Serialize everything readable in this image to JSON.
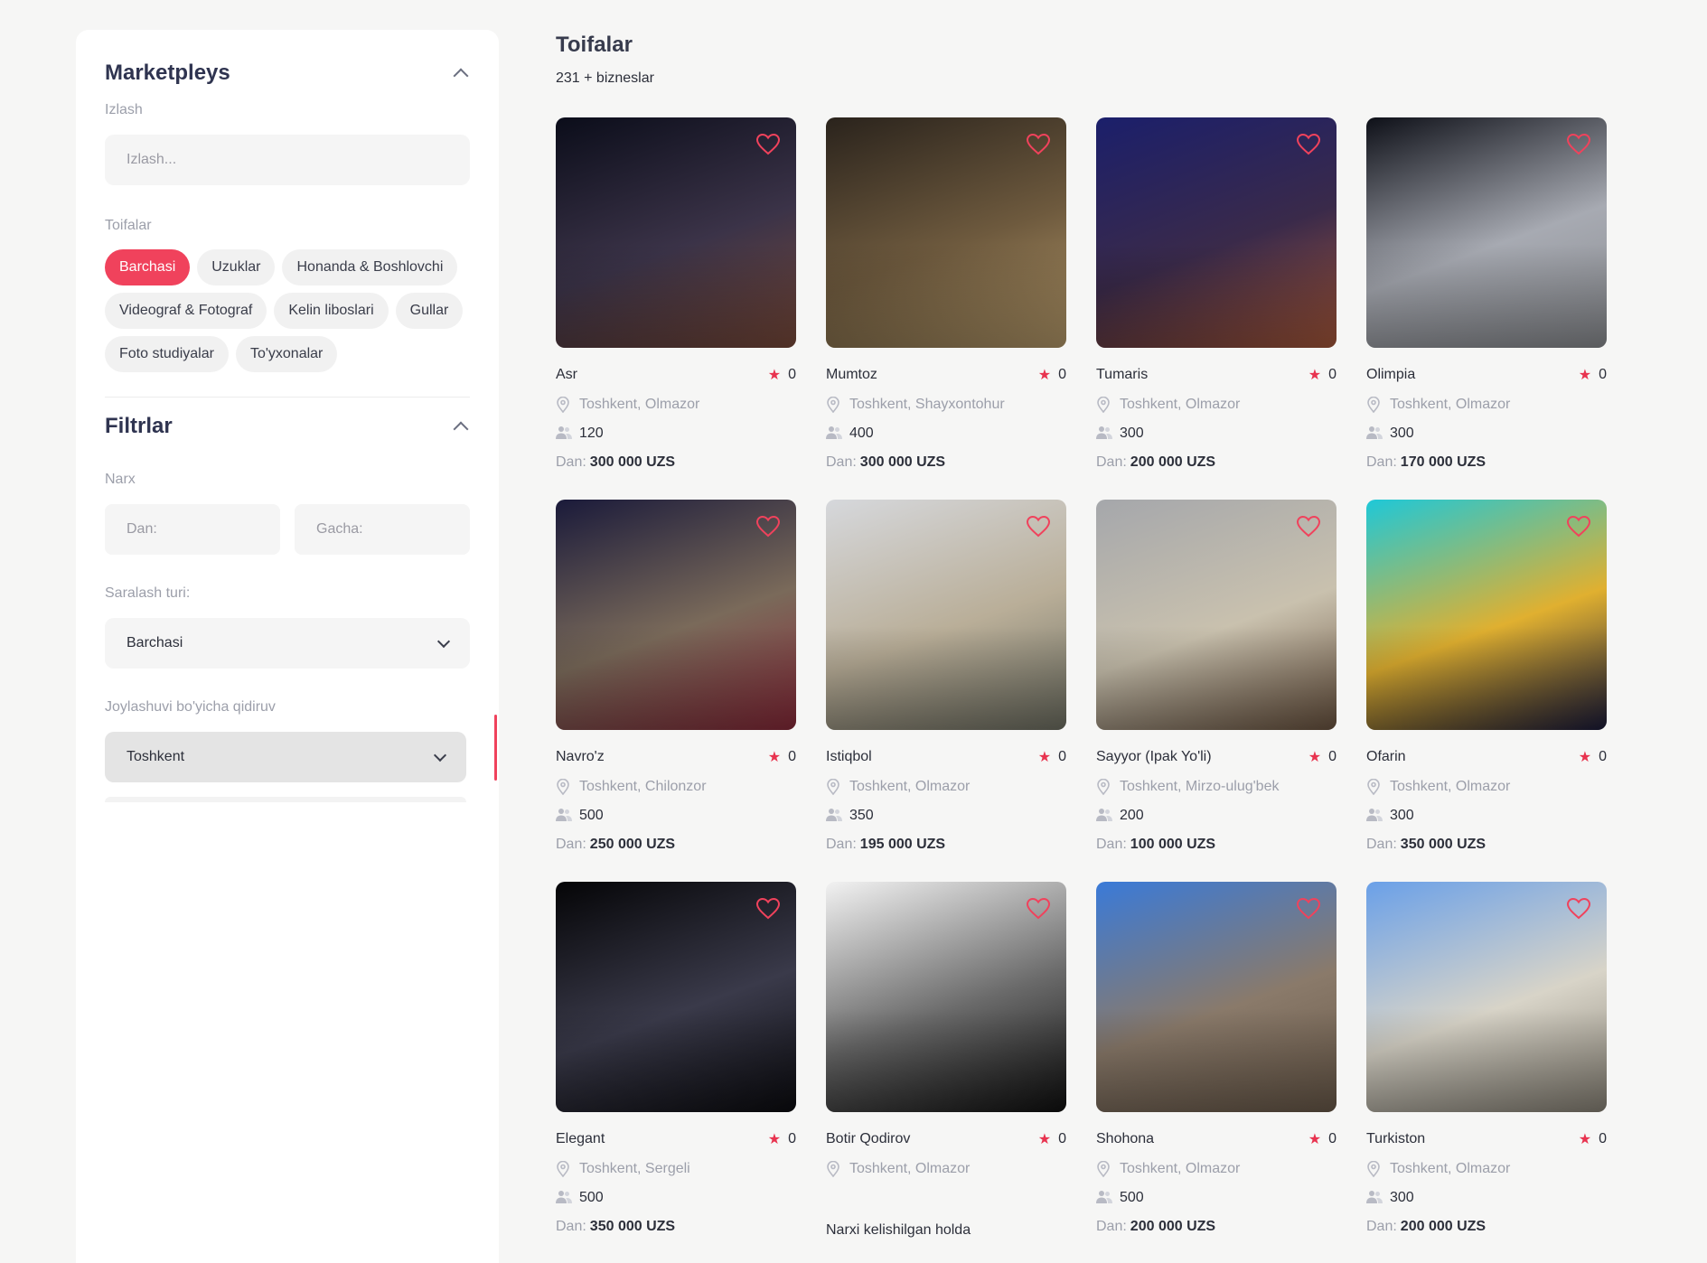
{
  "sidebar": {
    "marketplace_title": "Marketpleys",
    "search_label": "Izlash",
    "search_placeholder": "Izlash...",
    "categories_label": "Toifalar",
    "categories": [
      {
        "label": "Barchasi",
        "active": true
      },
      {
        "label": "Uzuklar",
        "active": false
      },
      {
        "label": "Honanda & Boshlovchi",
        "active": false
      },
      {
        "label": "Videograf & Fotograf",
        "active": false
      },
      {
        "label": "Kelin liboslari",
        "active": false
      },
      {
        "label": "Gullar",
        "active": false
      },
      {
        "label": "Foto studiyalar",
        "active": false
      },
      {
        "label": "To'yxonalar",
        "active": false
      }
    ],
    "filters_title": "Filtrlar",
    "price_label": "Narx",
    "price_from_placeholder": "Dan:",
    "price_to_placeholder": "Gacha:",
    "sort_label": "Saralash turi:",
    "sort_value": "Barchasi",
    "location_label": "Joylashuvi bo'yicha qidiruv",
    "location_value": "Toshkent"
  },
  "main": {
    "title": "Toifalar",
    "subtitle": "231 + bizneslar",
    "price_prefix": "Dan:",
    "cards": [
      {
        "name": "Asr",
        "rating": "0",
        "location": "Toshkent, Olmazor",
        "capacity": "120",
        "price": "300 000 UZS",
        "colors": [
          "#0b0d1a",
          "#3b3348",
          "#7a4a3a"
        ]
      },
      {
        "name": "Mumtoz",
        "rating": "0",
        "location": "Toshkent, Shayxontohur",
        "capacity": "400",
        "price": "300 000 UZS",
        "colors": [
          "#2a231c",
          "#6e5a3e",
          "#b69a6a"
        ]
      },
      {
        "name": "Tumaris",
        "rating": "0",
        "location": "Toshkent, Olmazor",
        "capacity": "300",
        "price": "200 000 UZS",
        "colors": [
          "#1b1f6b",
          "#3a2a4a",
          "#a8583a"
        ]
      },
      {
        "name": "Olimpia",
        "rating": "0",
        "location": "Toshkent, Olmazor",
        "capacity": "300",
        "price": "170 000 UZS",
        "colors": [
          "#0e1018",
          "#a7aab2",
          "#8a8c90"
        ]
      },
      {
        "name": "Navro'z",
        "rating": "0",
        "location": "Toshkent, Chilonzor",
        "capacity": "500",
        "price": "250 000 UZS",
        "colors": [
          "#1a1a3a",
          "#7a6a5a",
          "#8a2a3a"
        ]
      },
      {
        "name": "Istiqbol",
        "rating": "0",
        "location": "Toshkent, Olmazor",
        "capacity": "350",
        "price": "195 000 UZS",
        "colors": [
          "#d6d8dc",
          "#b9ae98",
          "#6f7063"
        ]
      },
      {
        "name": "Sayyor (Ipak Yo'li)",
        "rating": "0",
        "location": "Toshkent, Mirzo-ulug'bek",
        "capacity": "200",
        "price": "100 000 UZS",
        "colors": [
          "#a5a7ab",
          "#c9c1ae",
          "#6b5440"
        ]
      },
      {
        "name": "Ofarin",
        "rating": "0",
        "location": "Toshkent, Olmazor",
        "capacity": "300",
        "price": "350 000 UZS",
        "colors": [
          "#1ec8d8",
          "#e0b030",
          "#1a1a3a"
        ]
      },
      {
        "name": "Elegant",
        "rating": "0",
        "location": "Toshkent, Sergeli",
        "capacity": "500",
        "price": "350 000 UZS",
        "colors": [
          "#050507",
          "#3a3a4a",
          "#0c0c10"
        ]
      },
      {
        "name": "Botir Qodirov",
        "rating": "0",
        "location": "Toshkent, Olmazor",
        "capacity": "",
        "price": "",
        "negotiable": "Narxi kelishilgan holda",
        "colors": [
          "#f2f2f2",
          "#6a6a6a",
          "#101010"
        ]
      },
      {
        "name": "Shohona",
        "rating": "0",
        "location": "Toshkent, Olmazor",
        "capacity": "500",
        "price": "200 000 UZS",
        "colors": [
          "#3a7ad8",
          "#8a7a6a",
          "#6a5a4a"
        ]
      },
      {
        "name": "Turkiston",
        "rating": "0",
        "location": "Toshkent, Olmazor",
        "capacity": "300",
        "price": "200 000 UZS",
        "colors": [
          "#6aa0e8",
          "#d8d4c8",
          "#8a8478"
        ]
      }
    ]
  }
}
